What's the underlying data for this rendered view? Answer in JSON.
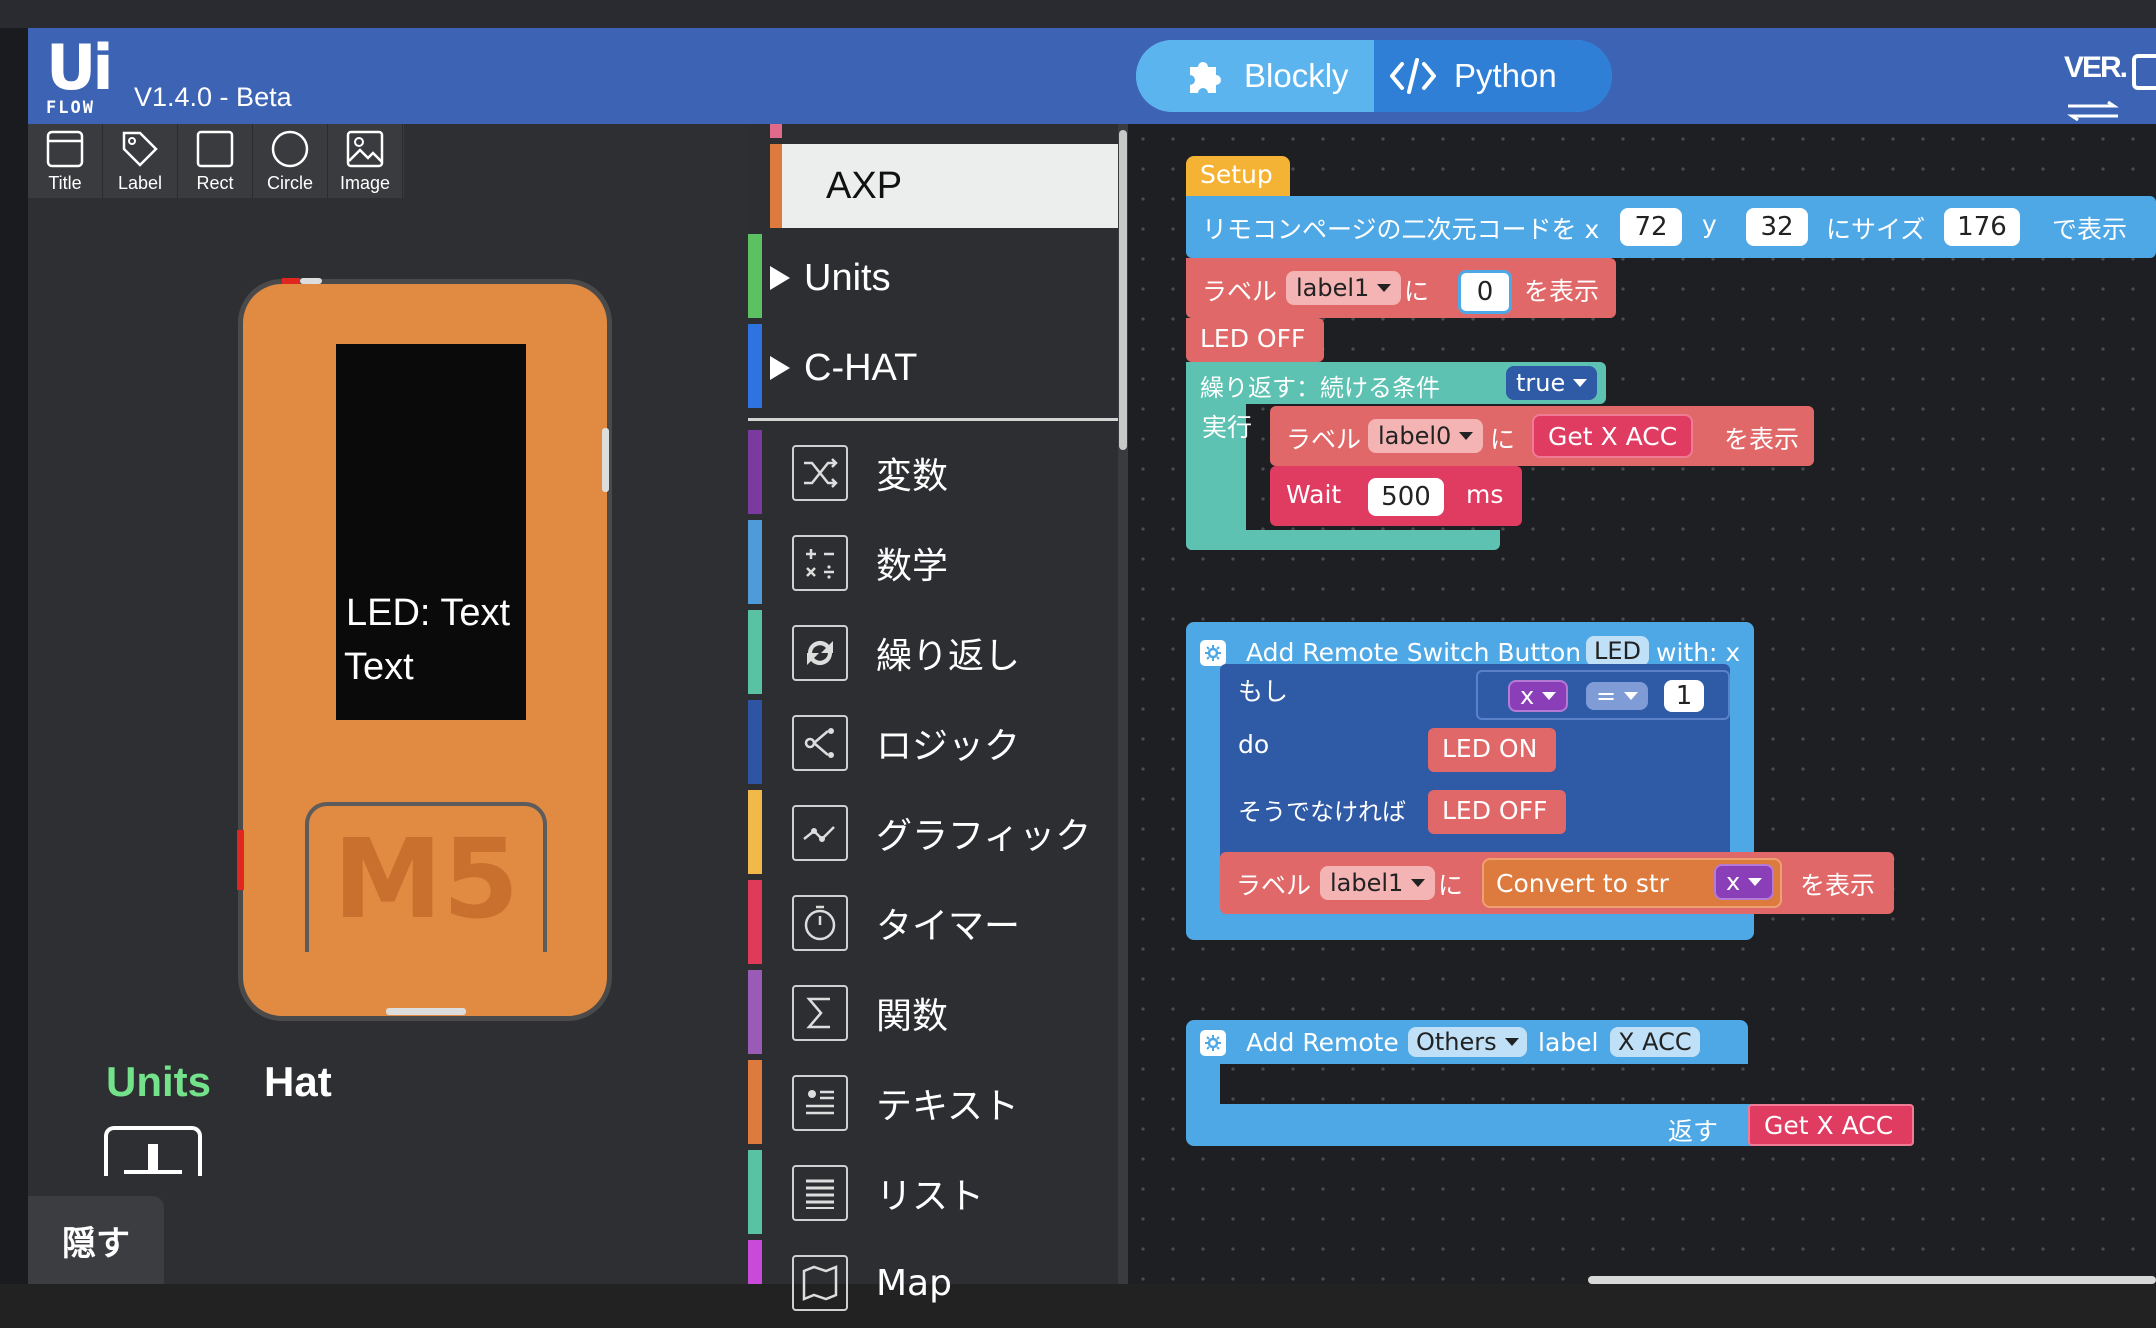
{
  "header": {
    "logo_top": "Ui",
    "logo_bottom": "FLOW",
    "version": "V1.4.0 - Beta",
    "mode_blockly": "Blockly",
    "mode_python": "Python",
    "ver_icon_text": "VER.",
    "colors": {
      "header_bg": "#3d63b5",
      "blockly_active": "#5cb4ef",
      "python": "#2f7fd6"
    }
  },
  "toolbar": {
    "items": [
      {
        "label": "Title",
        "icon": "title-icon"
      },
      {
        "label": "Label",
        "icon": "tag-icon"
      },
      {
        "label": "Rect",
        "icon": "rect-icon"
      },
      {
        "label": "Circle",
        "icon": "circle-icon"
      },
      {
        "label": "Image",
        "icon": "image-icon"
      }
    ]
  },
  "device": {
    "screen_line1": "LED: Text",
    "screen_line2": "Text",
    "button_label": "M5",
    "body_color": "#e08a42"
  },
  "bottom_tabs": {
    "units": "Units",
    "hat": "Hat",
    "hide_button": "隠す"
  },
  "categories": {
    "axp": "AXP",
    "tree": [
      {
        "label": "Units",
        "color": "#5cc160"
      },
      {
        "label": "C-HAT",
        "color": "#2f73e0"
      }
    ],
    "items": [
      {
        "label": "変数",
        "icon": "shuffle-icon",
        "color": "#7b3aa0"
      },
      {
        "label": "数学",
        "icon": "math-icon",
        "color": "#4f9ad8"
      },
      {
        "label": "繰り返し",
        "icon": "loop-icon",
        "color": "#58c2a2"
      },
      {
        "label": "ロジック",
        "icon": "logic-icon",
        "color": "#2d55a4"
      },
      {
        "label": "グラフィック",
        "icon": "graphic-icon",
        "color": "#f0b94a"
      },
      {
        "label": "タイマー",
        "icon": "timer-icon",
        "color": "#e03a5a"
      },
      {
        "label": "関数",
        "icon": "sigma-icon",
        "color": "#995bb6"
      },
      {
        "label": "テキスト",
        "icon": "text-icon",
        "color": "#dd7b3f"
      },
      {
        "label": "リスト",
        "icon": "list-icon",
        "color": "#58c2a2"
      },
      {
        "label": "Map",
        "icon": "map-icon",
        "color": "#c94ad8"
      }
    ]
  },
  "workspace": {
    "setup": {
      "hat": "Setup",
      "qr_prefix": "リモコンページの二次元コードを x",
      "qr_x": "72",
      "qr_y_label": "y",
      "qr_y": "32",
      "qr_size_label": "にサイズ",
      "qr_size": "176",
      "qr_suffix": "で表示",
      "label_prefix": "ラベル",
      "label_name": "label1",
      "label_ni": "に",
      "label_value": "0",
      "label_show": "を表示",
      "led_off": "LED OFF",
      "while_label": "繰り返す：続ける条件",
      "while_value": "true",
      "exec_label": "実行",
      "inner_label_prefix": "ラベル",
      "inner_label_name": "label0",
      "inner_label_ni": "に",
      "inner_label_value": "Get X ACC",
      "inner_label_show": "を表示",
      "wait_label": "Wait",
      "wait_value": "500",
      "wait_unit": "ms"
    },
    "switch_block": {
      "title": "Add Remote Switch Button",
      "name": "LED",
      "with": "with: x",
      "if_label": "もし",
      "cond_var": "x",
      "cond_op": "=",
      "cond_value": "1",
      "do_label": "do",
      "led_on": "LED ON",
      "else_label": "そうでなければ",
      "led_off": "LED OFF",
      "label_prefix": "ラベル",
      "label_name": "label1",
      "label_ni": "に",
      "convert": "Convert to str",
      "convert_var": "x",
      "label_show": "を表示"
    },
    "others_block": {
      "title": "Add Remote",
      "type": "Others",
      "label_word": "label",
      "label_value": "X ACC",
      "return_label": "返す",
      "return_value": "Get X ACC"
    },
    "colors": {
      "setup_hat": "#f5b335",
      "setup_blue": "#4fa8e6",
      "label_red": "#e06868",
      "loop_teal": "#5dc2b2",
      "wait_pink": "#e03c62",
      "logic_navy": "#2e5aa6",
      "var_purple": "#8a3fb8"
    }
  }
}
